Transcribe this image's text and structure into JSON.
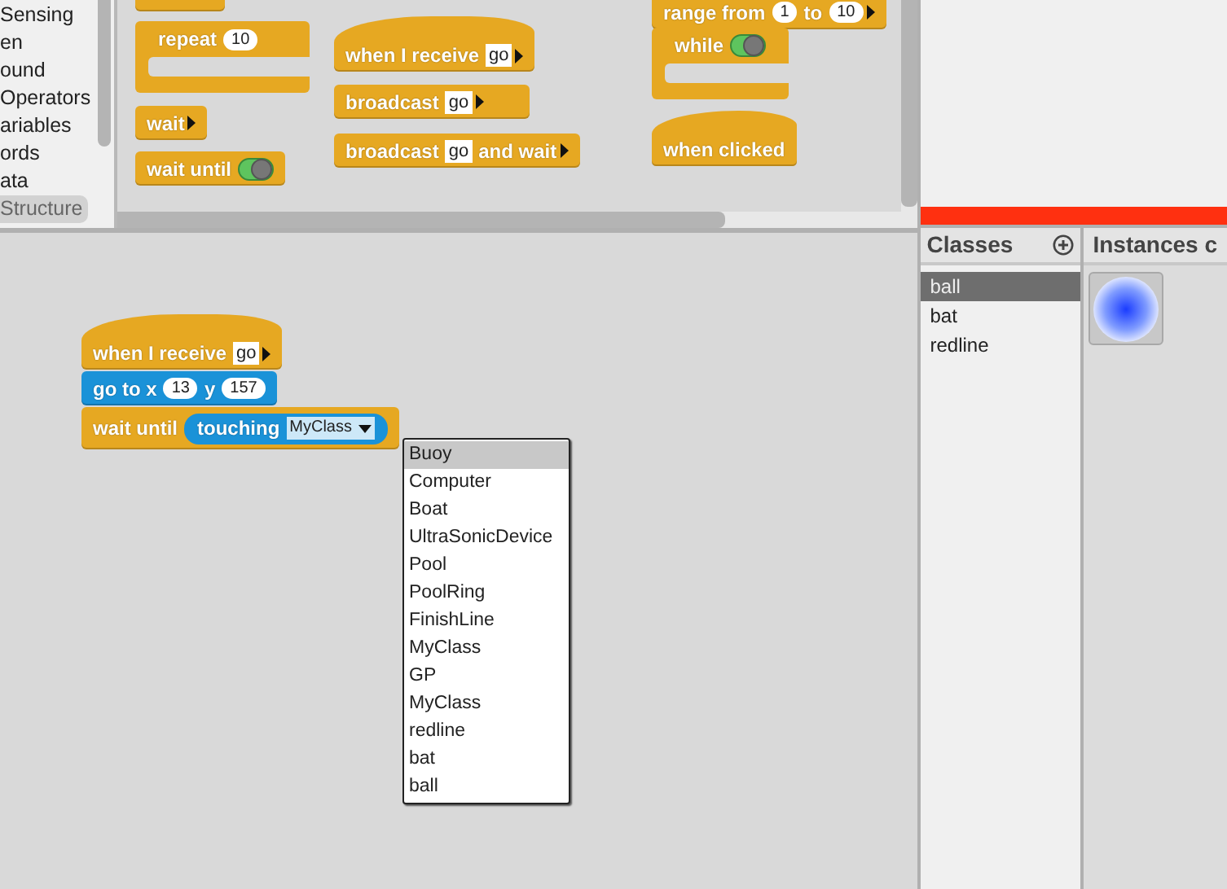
{
  "palette": {
    "categories": [
      {
        "label": "Sensing",
        "disabled": false
      },
      {
        "label": "en",
        "disabled": false
      },
      {
        "label": "ound",
        "disabled": false
      },
      {
        "label": "Operators",
        "disabled": false
      },
      {
        "label": "ariables",
        "disabled": false
      },
      {
        "label": "ords",
        "disabled": false
      },
      {
        "label": "ata",
        "disabled": false
      },
      {
        "label": "Structure",
        "disabled": true
      }
    ],
    "blocks": [
      {
        "kind": "command",
        "color": "#e6a822"
      },
      {
        "kind": "c",
        "color": "#e6a822",
        "parts": [
          {
            "kind": "label",
            "text": "repeat"
          },
          {
            "kind": "number",
            "text": "10"
          }
        ]
      },
      {
        "kind": "command",
        "color": "#e6a822",
        "parts": [
          {
            "kind": "label",
            "text": "wait"
          },
          {
            "kind": "arrow"
          }
        ]
      },
      {
        "kind": "command",
        "color": "#e6a822",
        "parts": [
          {
            "kind": "label",
            "text": "wait until"
          },
          {
            "kind": "toggle"
          }
        ]
      },
      {
        "kind": "hat",
        "color": "#e6a822",
        "parts": [
          {
            "kind": "label",
            "text": "when I receive"
          },
          {
            "kind": "slot",
            "text": "go"
          },
          {
            "kind": "arrow"
          }
        ]
      },
      {
        "kind": "command",
        "color": "#e6a822",
        "parts": [
          {
            "kind": "label",
            "text": "broadcast"
          },
          {
            "kind": "slot",
            "text": "go"
          },
          {
            "kind": "arrow"
          }
        ]
      },
      {
        "kind": "command",
        "color": "#e6a822",
        "parts": [
          {
            "kind": "label",
            "text": "broadcast"
          },
          {
            "kind": "slot",
            "text": "go"
          },
          {
            "kind": "label",
            "text": "and wait"
          },
          {
            "kind": "arrow"
          }
        ]
      },
      {
        "kind": "command",
        "color": "#e6a822",
        "parts": [
          {
            "kind": "label",
            "text": "range from"
          },
          {
            "kind": "number",
            "text": "1"
          },
          {
            "kind": "label",
            "text": "to"
          },
          {
            "kind": "number",
            "text": "10"
          },
          {
            "kind": "arrow"
          }
        ]
      },
      {
        "kind": "c",
        "color": "#e6a822",
        "parts": [
          {
            "kind": "label",
            "text": "while"
          },
          {
            "kind": "toggle"
          }
        ]
      },
      {
        "kind": "hat",
        "color": "#e6a822",
        "parts": [
          {
            "kind": "label",
            "text": "when clicked"
          }
        ]
      }
    ]
  },
  "script": {
    "blocks": [
      {
        "kind": "hat",
        "color": "#e6a822",
        "parts": [
          {
            "kind": "label",
            "text": "when I receive"
          },
          {
            "kind": "slot",
            "text": "go"
          },
          {
            "kind": "arrow"
          }
        ]
      },
      {
        "kind": "command",
        "color": "#1a92d8",
        "parts": [
          {
            "kind": "label",
            "text": "go to x"
          },
          {
            "kind": "number",
            "text": "13"
          },
          {
            "kind": "label",
            "text": "y"
          },
          {
            "kind": "number",
            "text": "157"
          }
        ]
      },
      {
        "kind": "command",
        "color": "#e6a822",
        "parts": [
          {
            "kind": "label",
            "text": "wait until"
          },
          {
            "kind": "reporter",
            "color": "#1a92d8",
            "parts": [
              {
                "kind": "label",
                "text": "touching"
              },
              {
                "kind": "dropdown",
                "text": "MyClass"
              }
            ]
          }
        ]
      }
    ]
  },
  "dropdown_menu": {
    "items": [
      {
        "label": "Buoy",
        "selected": true
      },
      {
        "label": "Computer",
        "selected": false
      },
      {
        "label": "Boat",
        "selected": false
      },
      {
        "label": "UltraSonicDevice",
        "selected": false
      },
      {
        "label": "Pool",
        "selected": false
      },
      {
        "label": "PoolRing",
        "selected": false
      },
      {
        "label": "FinishLine",
        "selected": false
      },
      {
        "label": "MyClass",
        "selected": false
      },
      {
        "label": "GP",
        "selected": false
      },
      {
        "label": "MyClass",
        "selected": false
      },
      {
        "label": "redline",
        "selected": false
      },
      {
        "label": "bat",
        "selected": false
      },
      {
        "label": "ball",
        "selected": false
      }
    ]
  },
  "classes": {
    "title": "Classes",
    "items": [
      {
        "label": "ball",
        "selected": true
      },
      {
        "label": "bat",
        "selected": false
      },
      {
        "label": "redline",
        "selected": false
      }
    ]
  },
  "instances": {
    "title": "Instances c"
  }
}
